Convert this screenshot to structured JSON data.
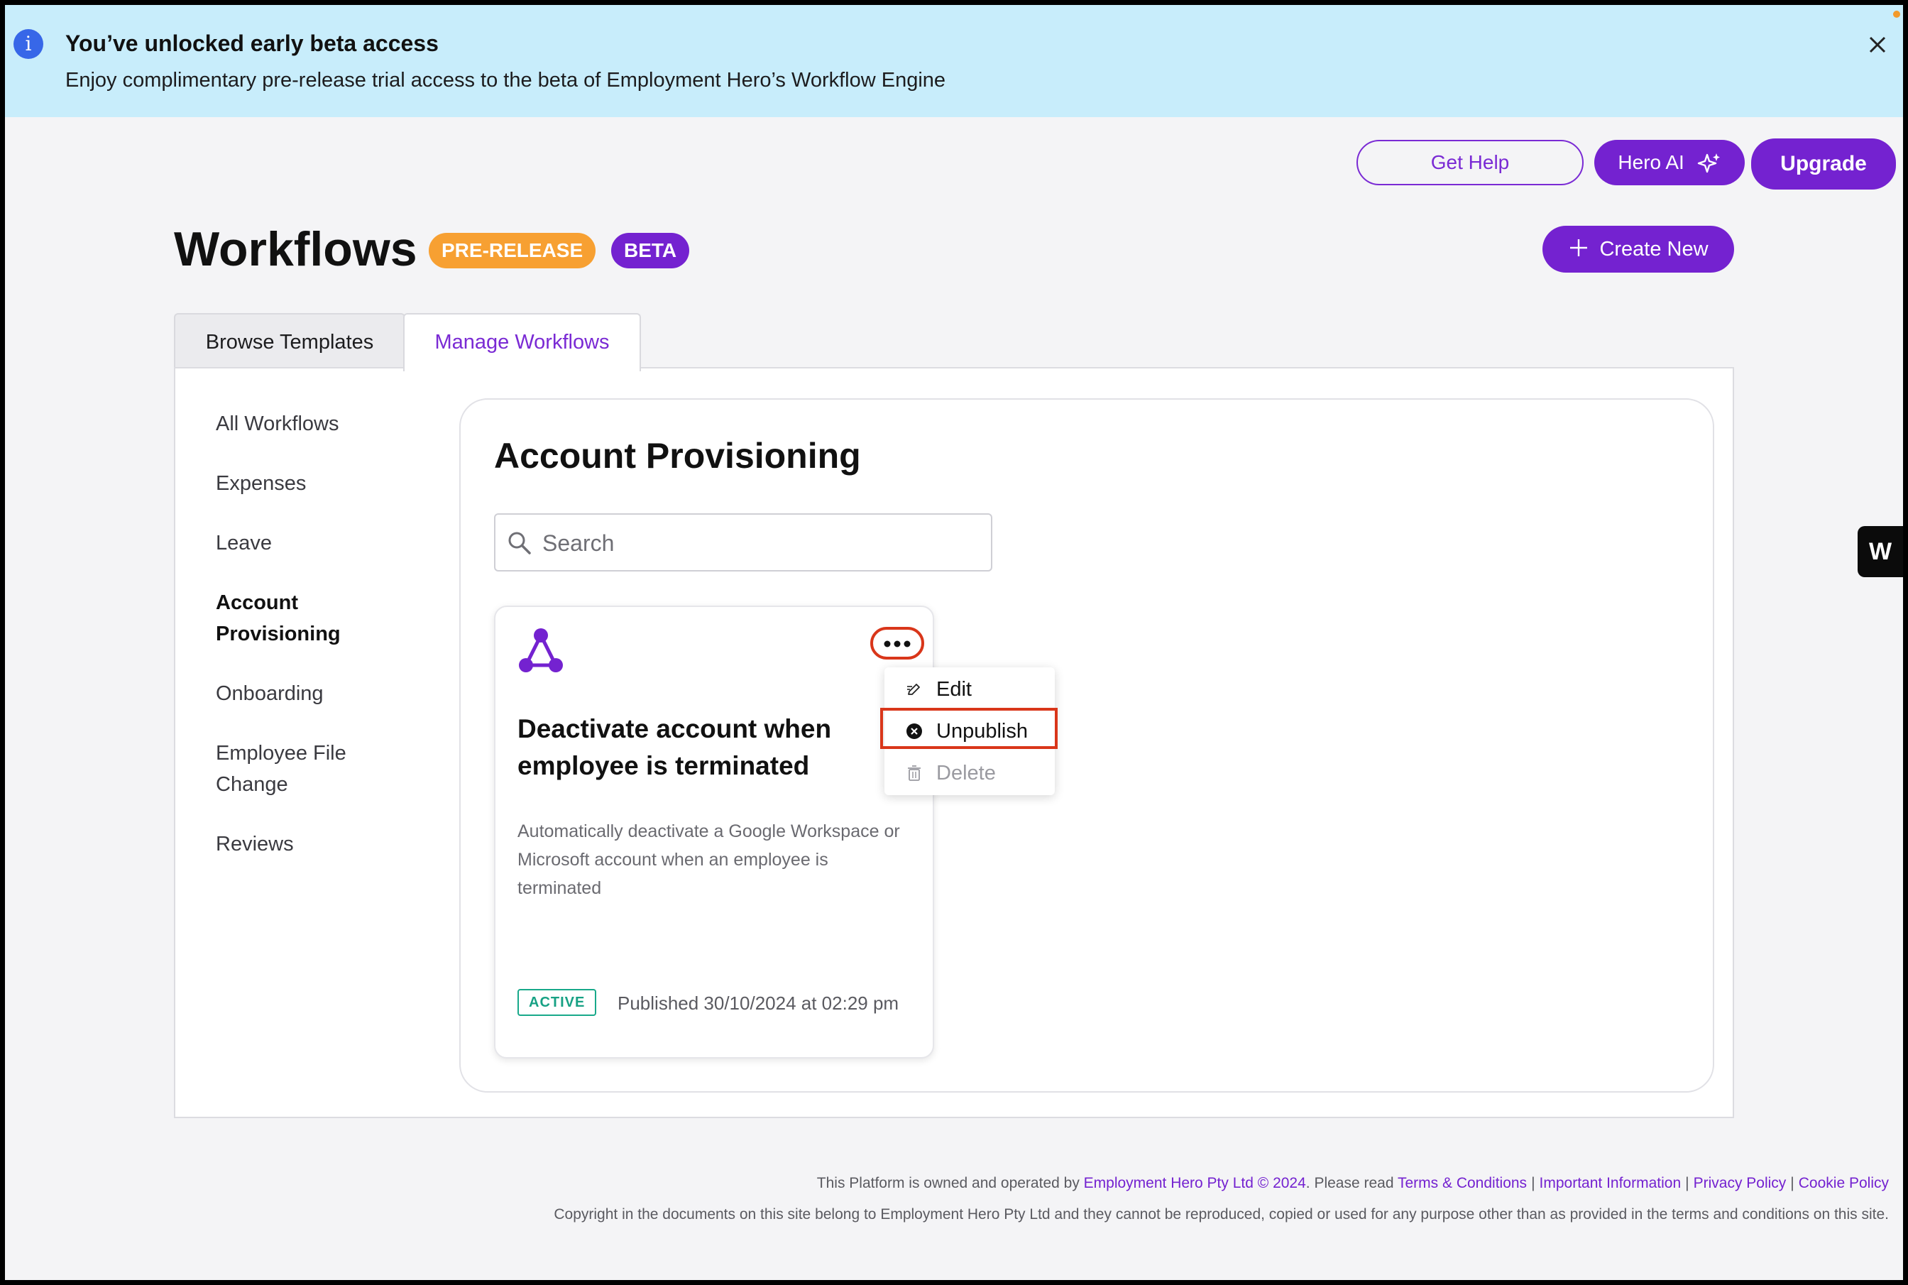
{
  "banner": {
    "title": "You’ve unlocked early beta access",
    "text": "Enjoy complimentary pre-release trial access to the beta of Employment Hero’s Workflow Engine"
  },
  "header": {
    "get_help": "Get Help",
    "hero_ai": "Hero AI",
    "upgrade": "Upgrade"
  },
  "page": {
    "title": "Workflows",
    "badge_pre_release": "PRE-RELEASE",
    "badge_beta": "BETA",
    "create_new": "Create New"
  },
  "tabs": [
    {
      "label": "Browse Templates"
    },
    {
      "label": "Manage Workflows"
    }
  ],
  "sidebar": {
    "items": [
      {
        "label": "All Workflows"
      },
      {
        "label": "Expenses"
      },
      {
        "label": "Leave"
      },
      {
        "label": "Account\nProvisioning"
      },
      {
        "label": "Onboarding"
      },
      {
        "label": "Employee File\nChange"
      },
      {
        "label": "Reviews"
      }
    ]
  },
  "main": {
    "title": "Account Provisioning",
    "search_placeholder": "Search"
  },
  "card": {
    "title": "Deactivate account when employee is terminated",
    "description": "Automatically deactivate a Google Workspace or Microsoft account when an employee is terminated",
    "status": "ACTIVE",
    "published": "Published 30/10/2024 at 02:29 pm"
  },
  "menu": {
    "edit": "Edit",
    "unpublish": "Unpublish",
    "delete": "Delete"
  },
  "footer": {
    "line1_prefix": "This Platform is owned and operated by ",
    "company_link": "Employment Hero Pty Ltd © 2024",
    "line1_mid": ". Please read ",
    "terms": "Terms & Conditions",
    "important": "Important Information",
    "privacy": "Privacy Policy",
    "cookie": "Cookie Policy",
    "line2": "Copyright in the documents on this site belong to Employment Hero Pty Ltd and they cannot be reproduced, copied or used for any purpose other than as provided in the terms and conditions on this site."
  },
  "widget": {
    "label": "W"
  },
  "colors": {
    "brand": "#7422d0",
    "banner_bg": "#c8edfb",
    "pre_release": "#f7a032",
    "active": "#17a184",
    "highlight": "#d9361a"
  }
}
